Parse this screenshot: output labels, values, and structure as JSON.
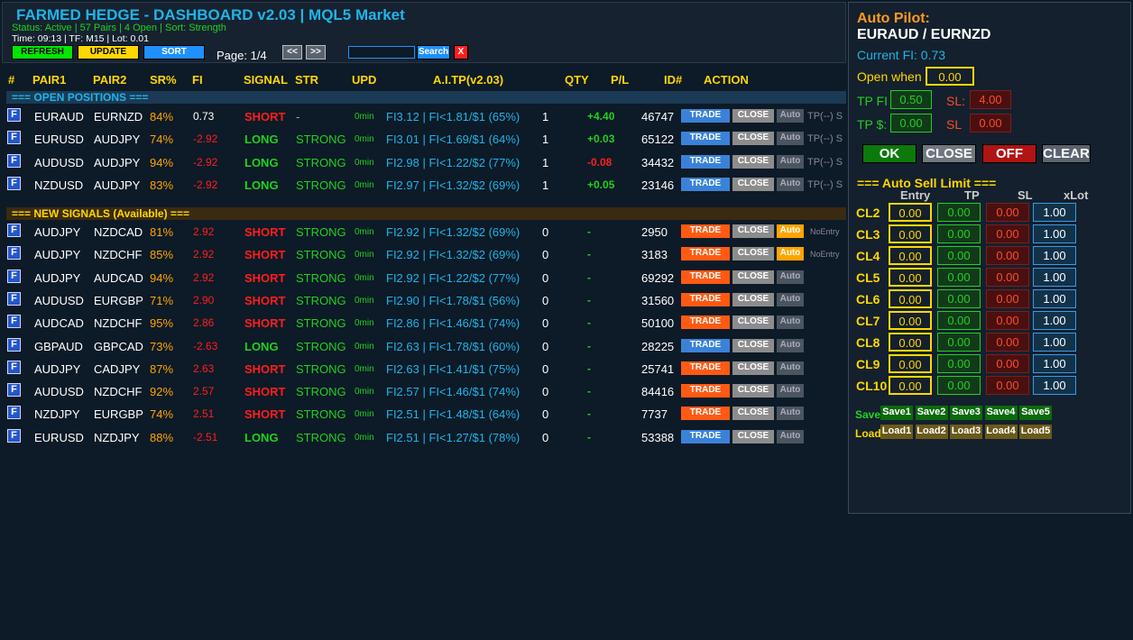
{
  "header": {
    "title": "FARMED HEDGE - DASHBOARD v2.03 | MQL5 Market",
    "status_line": "Status: Active | 57 Pairs | 4 Open | Sort: Strength",
    "time_line": "Time: 09:13 | TF: M15 | Lot: 0.01",
    "refresh_label": "REFRESH",
    "update_label": "UPDATE",
    "sort_label": "SORT",
    "page_label": "Page: 1/4",
    "prev_label": "<<",
    "next_label": ">>",
    "search_value": "",
    "search_label": "Search",
    "clear_search_label": "X"
  },
  "columns": [
    "#",
    "PAIR1",
    "PAIR2",
    "SR%",
    "FI",
    "SIGNAL",
    "STR",
    "UPD",
    "A.I.TP(v2.03)",
    "QTY",
    "P/L",
    "ID#",
    "ACTION"
  ],
  "sections": {
    "open": "=== OPEN POSITIONS ===",
    "new": "=== NEW SIGNALS (Available) ==="
  },
  "buttons": {
    "trade": "TRADE",
    "close": "CLOSE",
    "auto": "Auto",
    "tp_suffix": "TP(--) S",
    "no_entry": "NoEntry"
  },
  "open_positions": [
    {
      "icon": "F",
      "pair1": "EURAUD",
      "pair2": "EURNZD",
      "sr": "84%",
      "fi": "0.73",
      "signal": "SHORT",
      "str": "-",
      "upd": "0min",
      "ai": "FI3.12 | FI<1.81/$1 (65%)",
      "qty": "1",
      "pl": "+4.40",
      "id": "46747"
    },
    {
      "icon": "F",
      "pair1": "EURUSD",
      "pair2": "AUDJPY",
      "sr": "74%",
      "fi": "-2.92",
      "signal": "LONG",
      "str": "STRONG",
      "upd": "0min",
      "ai": "FI3.01 | FI<1.69/$1 (64%)",
      "qty": "1",
      "pl": "+0.03",
      "id": "65122"
    },
    {
      "icon": "F",
      "pair1": "AUDUSD",
      "pair2": "AUDJPY",
      "sr": "94%",
      "fi": "-2.92",
      "signal": "LONG",
      "str": "STRONG",
      "upd": "0min",
      "ai": "FI2.98 | FI<1.22/$2 (77%)",
      "qty": "1",
      "pl": "-0.08",
      "id": "34432"
    },
    {
      "icon": "F",
      "pair1": "NZDUSD",
      "pair2": "AUDJPY",
      "sr": "83%",
      "fi": "-2.92",
      "signal": "LONG",
      "str": "STRONG",
      "upd": "0min",
      "ai": "FI2.97 | FI<1.32/$2 (69%)",
      "qty": "1",
      "pl": "+0.05",
      "id": "23146"
    }
  ],
  "new_signals": [
    {
      "icon": "F",
      "pair1": "AUDJPY",
      "pair2": "NZDCAD",
      "sr": "81%",
      "fi": "2.92",
      "signal": "SHORT",
      "str": "STRONG",
      "upd": "0min",
      "ai": "FI2.92 | FI<1.32/$2 (69%)",
      "qty": "0",
      "pl": "-",
      "id": "2950",
      "auto_on": true,
      "note": "NoEntry"
    },
    {
      "icon": "F",
      "pair1": "AUDJPY",
      "pair2": "NZDCHF",
      "sr": "85%",
      "fi": "2.92",
      "signal": "SHORT",
      "str": "STRONG",
      "upd": "0min",
      "ai": "FI2.92 | FI<1.32/$2 (69%)",
      "qty": "0",
      "pl": "-",
      "id": "3183",
      "auto_on": true,
      "note": "NoEntry"
    },
    {
      "icon": "F",
      "pair1": "AUDJPY",
      "pair2": "AUDCAD",
      "sr": "94%",
      "fi": "2.92",
      "signal": "SHORT",
      "str": "STRONG",
      "upd": "0min",
      "ai": "FI2.92 | FI<1.22/$2 (77%)",
      "qty": "0",
      "pl": "-",
      "id": "69292",
      "auto_on": false,
      "note": ""
    },
    {
      "icon": "F",
      "pair1": "AUDUSD",
      "pair2": "EURGBP",
      "sr": "71%",
      "fi": "2.90",
      "signal": "SHORT",
      "str": "STRONG",
      "upd": "0min",
      "ai": "FI2.90 | FI<1.78/$1 (56%)",
      "qty": "0",
      "pl": "-",
      "id": "31560",
      "auto_on": false,
      "note": ""
    },
    {
      "icon": "F",
      "pair1": "AUDCAD",
      "pair2": "NZDCHF",
      "sr": "95%",
      "fi": "2.86",
      "signal": "SHORT",
      "str": "STRONG",
      "upd": "0min",
      "ai": "FI2.86 | FI<1.46/$1 (74%)",
      "qty": "0",
      "pl": "-",
      "id": "50100",
      "auto_on": false,
      "note": ""
    },
    {
      "icon": "F",
      "pair1": "GBPAUD",
      "pair2": "GBPCAD",
      "sr": "73%",
      "fi": "-2.63",
      "signal": "LONG",
      "str": "STRONG",
      "upd": "0min",
      "ai": "FI2.63 | FI<1.78/$1 (60%)",
      "qty": "0",
      "pl": "-",
      "id": "28225",
      "auto_on": false,
      "note": ""
    },
    {
      "icon": "F",
      "pair1": "AUDJPY",
      "pair2": "CADJPY",
      "sr": "87%",
      "fi": "2.63",
      "signal": "SHORT",
      "str": "STRONG",
      "upd": "0min",
      "ai": "FI2.63 | FI<1.41/$1 (75%)",
      "qty": "0",
      "pl": "-",
      "id": "25741",
      "auto_on": false,
      "note": ""
    },
    {
      "icon": "F",
      "pair1": "AUDUSD",
      "pair2": "NZDCHF",
      "sr": "92%",
      "fi": "2.57",
      "signal": "SHORT",
      "str": "STRONG",
      "upd": "0min",
      "ai": "FI2.57 | FI<1.46/$1 (74%)",
      "qty": "0",
      "pl": "-",
      "id": "84416",
      "auto_on": false,
      "note": ""
    },
    {
      "icon": "F",
      "pair1": "NZDJPY",
      "pair2": "EURGBP",
      "sr": "74%",
      "fi": "2.51",
      "signal": "SHORT",
      "str": "STRONG",
      "upd": "0min",
      "ai": "FI2.51 | FI<1.48/$1 (64%)",
      "qty": "0",
      "pl": "-",
      "id": "7737",
      "auto_on": false,
      "note": ""
    },
    {
      "icon": "F",
      "pair1": "EURUSD",
      "pair2": "NZDJPY",
      "sr": "88%",
      "fi": "-2.51",
      "signal": "LONG",
      "str": "STRONG",
      "upd": "0min",
      "ai": "FI2.51 | FI<1.27/$1 (78%)",
      "qty": "0",
      "pl": "-",
      "id": "53388",
      "auto_on": false,
      "note": ""
    }
  ],
  "autopilot": {
    "heading": "Auto Pilot:",
    "pair": "EURAUD / EURNZD",
    "current_fi": "Current FI: 0.73",
    "open_when_label": "Open when",
    "open_when_value": "0.00",
    "tp_fi_label": "TP FI",
    "tp_fi_value": "0.50",
    "sl1_label": "SL:",
    "sl1_value": "4.00",
    "tp_usd_label": "TP $:",
    "tp_usd_value": "0.00",
    "sl2_label": "SL",
    "sl2_value": "0.00",
    "ok_label": "OK",
    "close_label": "CLOSE",
    "off_label": "OFF",
    "clear_label": "CLEAR",
    "sell_limit_title": "=== Auto Sell Limit ===",
    "sell_cols": [
      "Entry",
      "TP",
      "SL",
      "xLot"
    ],
    "cl_rows": [
      {
        "label": "CL2",
        "entry": "0.00",
        "tp": "0.00",
        "sl": "0.00",
        "xlot": "1.00"
      },
      {
        "label": "CL3",
        "entry": "0.00",
        "tp": "0.00",
        "sl": "0.00",
        "xlot": "1.00"
      },
      {
        "label": "CL4",
        "entry": "0.00",
        "tp": "0.00",
        "sl": "0.00",
        "xlot": "1.00"
      },
      {
        "label": "CL5",
        "entry": "0.00",
        "tp": "0.00",
        "sl": "0.00",
        "xlot": "1.00"
      },
      {
        "label": "CL6",
        "entry": "0.00",
        "tp": "0.00",
        "sl": "0.00",
        "xlot": "1.00"
      },
      {
        "label": "CL7",
        "entry": "0.00",
        "tp": "0.00",
        "sl": "0.00",
        "xlot": "1.00"
      },
      {
        "label": "CL8",
        "entry": "0.00",
        "tp": "0.00",
        "sl": "0.00",
        "xlot": "1.00"
      },
      {
        "label": "CL9",
        "entry": "0.00",
        "tp": "0.00",
        "sl": "0.00",
        "xlot": "1.00"
      },
      {
        "label": "CL10",
        "entry": "0.00",
        "tp": "0.00",
        "sl": "0.00",
        "xlot": "1.00"
      }
    ],
    "save_label": "Save",
    "load_label": "Load",
    "save_buttons": [
      "Save1",
      "Save2",
      "Save3",
      "Save4",
      "Save5"
    ],
    "load_buttons": [
      "Load1",
      "Load2",
      "Load3",
      "Load4",
      "Load5"
    ]
  },
  "colors": {
    "background": "#0d1a27",
    "title": "#1fb4e8",
    "status_green": "#1fd21f",
    "header_gold": "#ffd700",
    "short_red": "#ff1e1e",
    "long_green": "#1fd21f",
    "trade_blue": "#3a82d8",
    "trade_orange": "#ff5a14",
    "close_gray": "#8c8c8c",
    "auto_orange": "#ffa500",
    "autopilot_orange": "#ff9a1f"
  }
}
